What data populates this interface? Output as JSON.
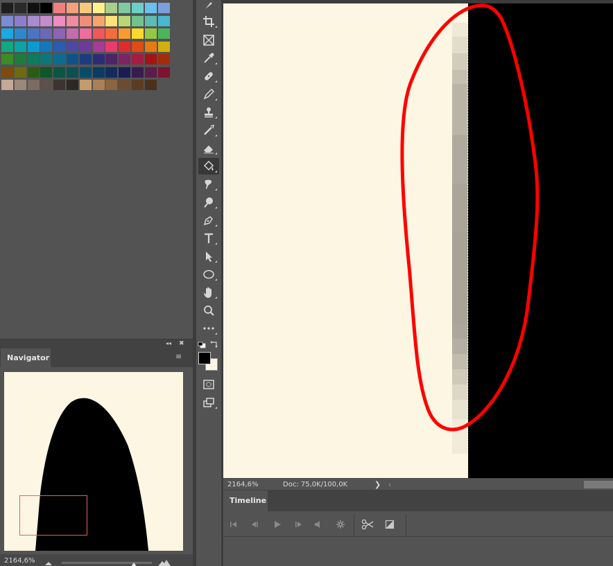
{
  "swatches": {
    "rows": [
      [
        "#1e1e1e",
        "#2a2a2a",
        "#111111",
        "#000000",
        "#f08080",
        "#f4a07a",
        "#f8c87c",
        "#fef28a",
        "#a8d08d",
        "#7fcaa0",
        "#6ccfc8",
        "#6cc0f0",
        "#7aa0dc"
      ],
      [
        "#7e8cd4",
        "#8c7ecc",
        "#a88cd0",
        "#c48ccc",
        "#f08cc0",
        "#f08ca0",
        "#f48c7c",
        "#f8a46c",
        "#fce47a",
        "#b8d878",
        "#70c48c",
        "#5cbcb4",
        "#4ab8d0"
      ],
      [
        "#1ca8e4",
        "#2c88d0",
        "#4c74c4",
        "#6c68b8",
        "#8c64b4",
        "#c46cb0",
        "#f06c9c",
        "#f0585c",
        "#f46c3c",
        "#f89c30",
        "#fcd82c",
        "#94c844",
        "#4cb45c"
      ],
      [
        "#12a882",
        "#0ca4a4",
        "#0a9cd0",
        "#1478c0",
        "#2c5cb0",
        "#4c48a4",
        "#6c3c98",
        "#a83c94",
        "#e83c6c",
        "#e02c2c",
        "#e04c14",
        "#e47c10",
        "#d0b00c"
      ],
      [
        "#3c8c28",
        "#1c7c3c",
        "#0c7c5c",
        "#0a7878",
        "#0a6c90",
        "#0c5488",
        "#1c3c80",
        "#2c2c74",
        "#4c2468",
        "#7c2464",
        "#a41c44",
        "#a41414",
        "#a42c0c"
      ],
      [
        "#7c4c0c",
        "#6c6c0c",
        "#2c5c14",
        "#0c5828",
        "#0c5444",
        "#0c5054",
        "#0a4c68",
        "#0a3c64",
        "#142c5c",
        "#1c1c54",
        "#381c50",
        "#5c1c4c",
        "#7c1430"
      ],
      [
        "#c4a898",
        "#9c8878",
        "#7c6c60",
        "#5c5048",
        "#3c3430",
        "#2c2824",
        "#c49c6c",
        "#ac8054",
        "#8c6440",
        "#6c4c30",
        "#5c3c24",
        "#4c301c"
      ]
    ]
  },
  "navigator": {
    "panel_title": "Navigator",
    "viewbox_color": "#e8605a"
  },
  "zoom": "2164,6%",
  "doc_info": "Doc: 75,0K/100,0K",
  "status_more": "❯",
  "scroll_left": "‹",
  "timeline": {
    "panel_title": "Timeline"
  },
  "colors": {
    "foreground": "#000000",
    "background": "#fdf6e3",
    "annotation": "#ff0000"
  },
  "icons": {
    "collapse": "◂◂",
    "close": "✖",
    "menu": "≡"
  }
}
